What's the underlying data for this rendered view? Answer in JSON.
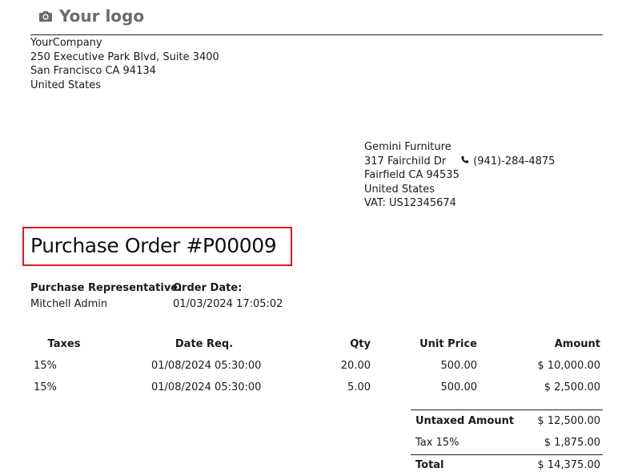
{
  "header": {
    "logo_text": "Your logo",
    "logo_icon": "camera-icon"
  },
  "company": {
    "name": "YourCompany",
    "street": "250 Executive Park Blvd, Suite 3400",
    "city_line": "San Francisco CA 94134",
    "country": "United States"
  },
  "vendor": {
    "name": "Gemini Furniture",
    "street": "317 Fairchild Dr",
    "phone_icon": "phone-icon",
    "phone": "(941)-284-4875",
    "city_line": "Fairfield CA 94535",
    "country": "United States",
    "vat": "VAT: US12345674"
  },
  "document": {
    "title": "Purchase Order #P00009",
    "highlight_color": "#e0161b"
  },
  "info": {
    "rep_label": "Purchase Representative:",
    "rep_value": "Mitchell Admin",
    "date_label": "Order Date:",
    "date_value": "01/03/2024 17:05:02"
  },
  "lines": {
    "headers": {
      "taxes": "Taxes",
      "date_req": "Date Req.",
      "qty": "Qty",
      "unit_price": "Unit Price",
      "amount": "Amount"
    },
    "rows": [
      {
        "taxes": "15%",
        "date_req": "01/08/2024 05:30:00",
        "qty": "20.00",
        "unit_price": "500.00",
        "amount": "$ 10,000.00"
      },
      {
        "taxes": "15%",
        "date_req": "01/08/2024 05:30:00",
        "qty": "5.00",
        "unit_price": "500.00",
        "amount": "$ 2,500.00"
      }
    ]
  },
  "totals": {
    "untaxed_label": "Untaxed Amount",
    "untaxed_value": "$ 12,500.00",
    "tax_label": "Tax 15%",
    "tax_value": "$ 1,875.00",
    "total_label": "Total",
    "total_value": "$ 14,375.00"
  }
}
